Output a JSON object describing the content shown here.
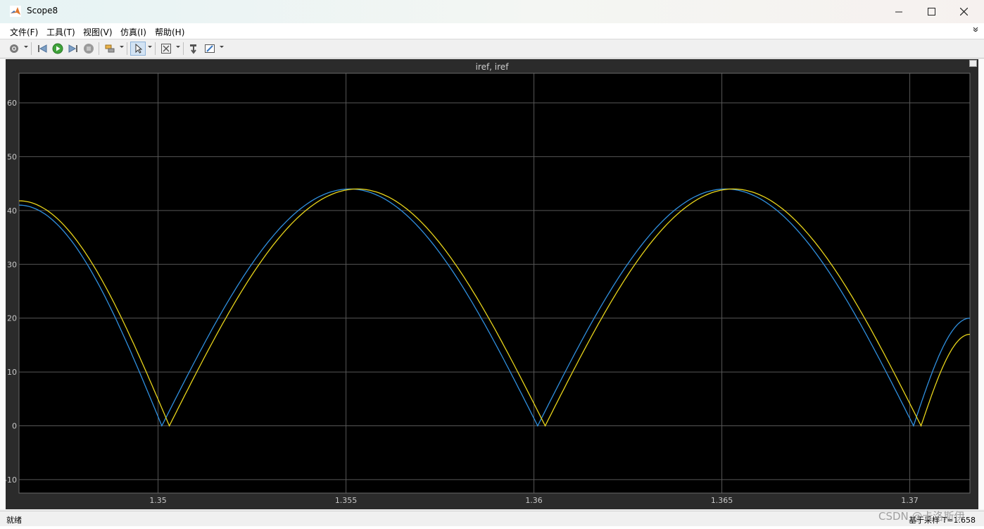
{
  "window": {
    "title": "Scope8"
  },
  "menu": [
    "文件(F)",
    "工具(T)",
    "视图(V)",
    "仿真(I)",
    "帮助(H)"
  ],
  "toolbar": [
    {
      "icon": "gear-icon"
    },
    {
      "icon": "step-back-icon"
    },
    {
      "icon": "run-icon"
    },
    {
      "icon": "step-forward-icon"
    },
    {
      "icon": "stop-icon"
    },
    {
      "icon": "highlight-icon"
    },
    {
      "icon": "cursor-icon"
    },
    {
      "icon": "zoom-icon"
    },
    {
      "icon": "autoscale-icon"
    },
    {
      "icon": "style-icon"
    }
  ],
  "colors": {
    "series1": "#2f8fde",
    "series2": "#e8d41a",
    "background": "#000000",
    "grid": "#575757"
  },
  "status": {
    "left": "就绪",
    "right": "基于采样  T=1.658"
  },
  "watermark": "CSDN @卡洛斯伊",
  "chart_data": {
    "type": "line",
    "title": "iref, iref",
    "xlim": [
      1.3463,
      1.3716
    ],
    "ylim": [
      -12.5,
      65.5
    ],
    "xticks": [
      1.35,
      1.355,
      1.36,
      1.365,
      1.37
    ],
    "xtick_labels": [
      "1.35",
      "1.355",
      "1.36",
      "1.365",
      "1.37"
    ],
    "yticks": [
      -10,
      0,
      10,
      20,
      30,
      40,
      50,
      60
    ],
    "ytick_labels": [
      "-10",
      "0",
      "10",
      "20",
      "30",
      "40",
      "50",
      "60"
    ],
    "grid": true,
    "series": [
      {
        "color": "#2f8fde",
        "x": [
          1.3463,
          1.3501,
          1.3551,
          1.3601,
          1.3651,
          1.3701,
          1.3716
        ],
        "y": [
          41,
          0,
          44,
          0,
          44,
          0,
          20
        ]
      },
      {
        "color": "#e8d41a",
        "x": [
          1.3463,
          1.3503,
          1.3553,
          1.3603,
          1.3653,
          1.3703,
          1.3716
        ],
        "y": [
          41.8,
          0,
          44,
          0,
          44,
          0,
          17
        ]
      }
    ]
  }
}
